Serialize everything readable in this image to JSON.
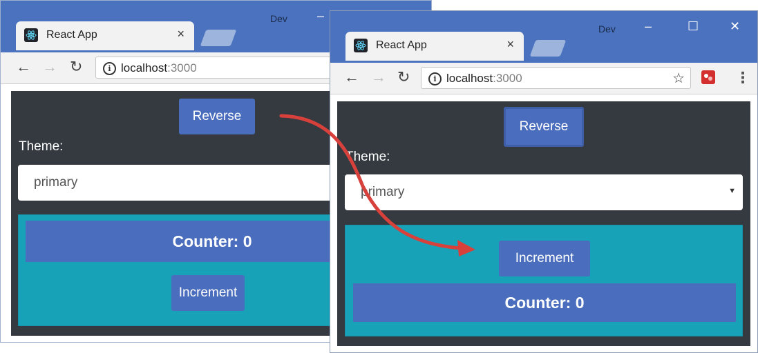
{
  "colors": {
    "titlebar": "#4a72be",
    "app_bg": "#343a40",
    "button_blue": "#4a6ebd",
    "teal_panel": "#17a2b8",
    "arrow": "#d8413b"
  },
  "before": {
    "tab": {
      "title": "React App",
      "close": "×",
      "favicon": "react-logo-icon"
    },
    "profile_label": "Dev",
    "window_controls": [
      "–"
    ],
    "address": {
      "host": "localhost",
      "port": ":3000"
    },
    "app": {
      "reverse_label": "Reverse",
      "theme_label": "Theme:",
      "theme_value": "primary",
      "counter_text": "Counter: 0",
      "increment_label": "Increment"
    }
  },
  "after": {
    "tab": {
      "title": "React App",
      "close": "×",
      "favicon": "react-logo-icon"
    },
    "profile_label": "Dev",
    "window_controls": [
      "–",
      "☐",
      "✕"
    ],
    "address": {
      "host": "localhost",
      "port": ":3000"
    },
    "toolbar_icons": [
      "star-icon",
      "extension-icon",
      "menu-dots-icon"
    ],
    "app": {
      "reverse_label": "Reverse",
      "theme_label": "Theme:",
      "theme_value": "primary",
      "increment_label": "Increment",
      "counter_text": "Counter: 0"
    }
  }
}
